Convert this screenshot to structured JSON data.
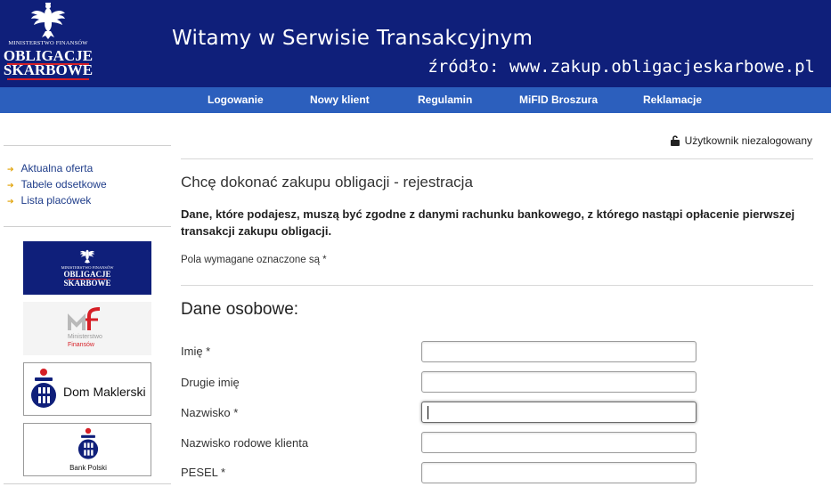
{
  "header": {
    "logo": {
      "ministry": "MINISTERSTWO FINANSÓW",
      "line1": "OBLIGACJE",
      "line2": "SKARBOWE"
    },
    "welcome": "Witamy w Serwisie Transakcyjnym",
    "source": "źródło: www.zakup.obligacjeskarbowe.pl"
  },
  "nav": {
    "items": [
      "Logowanie",
      "Nowy klient",
      "Regulamin",
      "MiFID Broszura",
      "Reklamacje"
    ]
  },
  "sidebar": {
    "links": [
      "Aktualna oferta",
      "Tabele odsetkowe",
      "Lista placówek"
    ],
    "banners": {
      "ob_ministry": "MINISTERSTWO FINANSÓW",
      "ob_line1": "OBLIGACJE",
      "ob_line2": "SKARBOWE",
      "mf_line1": "Ministerstwo",
      "mf_line2": "Finansów",
      "dm": "Dom Maklerski",
      "bp": "Bank Polski"
    }
  },
  "main": {
    "user_status": "Użytkownik niezalogowany",
    "title": "Chcę dokonać zakupu obligacji - rejestracja",
    "warning": "Dane, które podajesz, muszą być zgodne z danymi rachunku bankowego, z którego nastąpi opłacenie pierwszej transakcji zakupu obligacji.",
    "required_note": "Pola wymagane oznaczone są *",
    "section": "Dane osobowe:",
    "fields": [
      {
        "label": "Imię *",
        "value": ""
      },
      {
        "label": "Drugie imię",
        "value": ""
      },
      {
        "label": "Nazwisko *",
        "value": ""
      },
      {
        "label": "Nazwisko rodowe klienta",
        "value": ""
      },
      {
        "label": "PESEL *",
        "value": ""
      }
    ]
  },
  "colors": {
    "header_bg": "#0f1f7a",
    "nav_bg": "#2c5fbd",
    "logo_red": "#d61f26",
    "link_arrow": "#e0a000"
  }
}
